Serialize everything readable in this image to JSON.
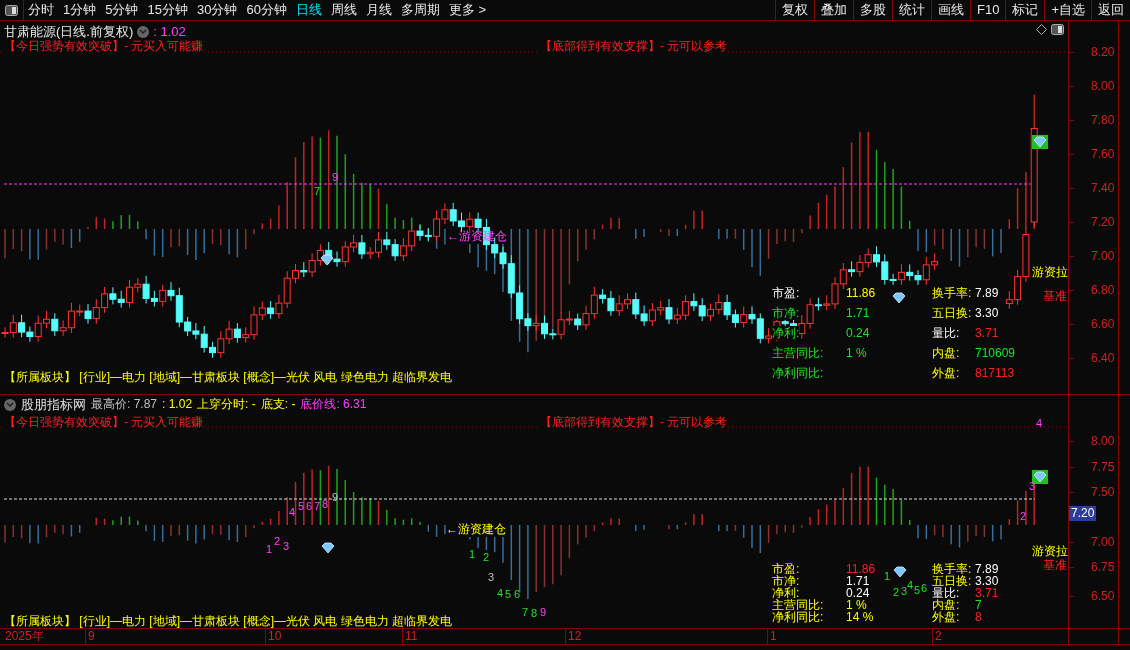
{
  "toolbar": {
    "period_tabs": [
      {
        "label": "分时",
        "selected": false
      },
      {
        "label": "1分钟",
        "selected": false
      },
      {
        "label": "5分钟",
        "selected": false
      },
      {
        "label": "15分钟",
        "selected": false
      },
      {
        "label": "30分钟",
        "selected": false
      },
      {
        "label": "60分钟",
        "selected": false
      },
      {
        "label": "日线",
        "selected": true
      },
      {
        "label": "周线",
        "selected": false
      },
      {
        "label": "月线",
        "selected": false
      },
      {
        "label": "多周期",
        "selected": false
      },
      {
        "label": "更多 >",
        "selected": false
      }
    ],
    "buttons": [
      "复权",
      "叠加",
      "多股",
      "统计",
      "画线",
      "F10",
      "标记",
      "+自选",
      "返回"
    ]
  },
  "main_chart": {
    "title": "甘肃能源(日线.前复权)",
    "value": ": 1.02",
    "signals": [
      "【今日强势有效突破】- 元买入可能赚",
      "【底部得到有效支撑】- 元可以参考"
    ],
    "price_ticks": [
      "8.20",
      "8.00",
      "7.80",
      "7.60",
      "7.40",
      "7.20",
      "7.00",
      "6.80",
      "6.60",
      "6.40"
    ],
    "annotations": [
      {
        "text": "←游资建仓"
      },
      {
        "text": "游资拉"
      },
      {
        "text": "基准"
      }
    ],
    "markers": [
      {
        "text": "7"
      },
      {
        "text": "9"
      }
    ],
    "stats_left": [
      {
        "label": "市盈:",
        "value": "11.86"
      },
      {
        "label": "市净:",
        "value": "1.71"
      },
      {
        "label": "净利:",
        "value": "0.24"
      },
      {
        "label": "主营同比:",
        "value": "1 %"
      },
      {
        "label": "净利同比:"
      }
    ],
    "stats_right": [
      {
        "label": "换手率:",
        "value": "7.89"
      },
      {
        "label": "五日换:",
        "value": "3.30"
      },
      {
        "label": "量比:",
        "value": "3.71"
      },
      {
        "label": "内盘:",
        "value": "710609"
      },
      {
        "label": "外盘:",
        "value": "817113"
      }
    ],
    "sector_line": "【所属板块】 [行业]—电力 [地域]—甘肃板块 [概念]—光伏 风电 绿色电力 超临界发电"
  },
  "indicator_chart": {
    "info": [
      "股朋指标网",
      "最高价: 7.87",
      ": 1.02",
      "上穿分时: -",
      "底支: -",
      "底价线: 6.31"
    ],
    "signals": [
      "【今日强势有效突破】- 元买入可能赚",
      "【底部得到有效支撑】- 元可以参考"
    ],
    "price_ticks": [
      "8.00",
      "7.75",
      "7.50",
      "7.00",
      "6.75",
      "6.50"
    ],
    "current_price": "7.20",
    "annotations": [
      {
        "text": "←游资建仓"
      },
      {
        "text": "游资拉"
      },
      {
        "text": "基准"
      }
    ],
    "markers": [
      {
        "text": "4"
      },
      {
        "text": "5"
      },
      {
        "text": "6"
      },
      {
        "text": "7"
      },
      {
        "text": "8"
      },
      {
        "text": "9"
      },
      {
        "text": "1"
      },
      {
        "text": "2"
      },
      {
        "text": "3"
      },
      {
        "text": "1"
      },
      {
        "text": "2"
      },
      {
        "text": "3"
      },
      {
        "text": "4"
      },
      {
        "text": "5"
      },
      {
        "text": "6"
      },
      {
        "text": "7"
      },
      {
        "text": "8"
      },
      {
        "text": "9"
      },
      {
        "text": "1"
      },
      {
        "text": "2"
      },
      {
        "text": "3"
      },
      {
        "text": "4"
      },
      {
        "text": "5"
      },
      {
        "text": "6"
      },
      {
        "text": "2"
      },
      {
        "text": "3"
      },
      {
        "text": "4"
      }
    ],
    "stats_left": [
      {
        "label": "市盈:",
        "value": "11.86"
      },
      {
        "label": "市净:",
        "value": "1.71"
      },
      {
        "label": "净利:",
        "value": "0.24"
      },
      {
        "label": "主营同比:",
        "value": "1 %"
      },
      {
        "label": "净利同比:",
        "value": "14 %"
      }
    ],
    "stats_right": [
      {
        "label": "换手率:",
        "value": "7.89"
      },
      {
        "label": "五日换:",
        "value": "3.30"
      },
      {
        "label": "量比:",
        "value": "3.71"
      },
      {
        "label": "内盘:",
        "value": "7"
      },
      {
        "label": "外盘:",
        "value": "8"
      }
    ],
    "sector_line": "【所属板块】 [行业]—电力 [地域]—甘肃板块 [概念]—光伏 风电 绿色电力 超临界发电"
  },
  "date_axis": [
    "2025年",
    "9",
    "10",
    "11",
    "12",
    "1",
    "2"
  ]
}
